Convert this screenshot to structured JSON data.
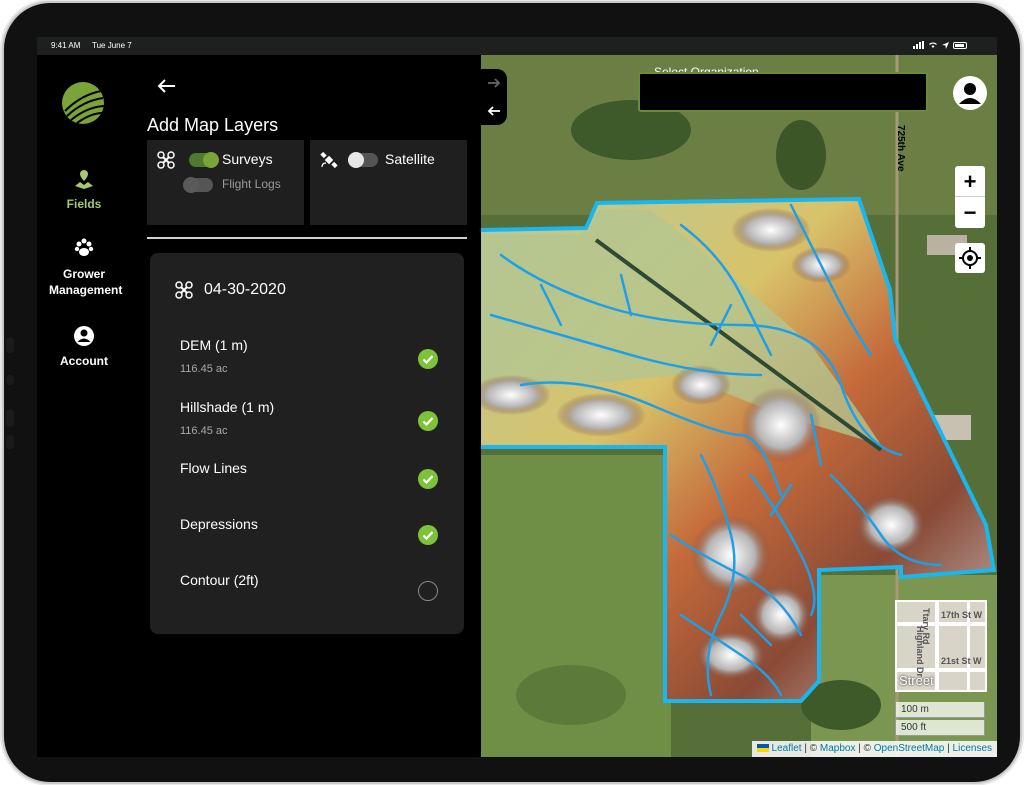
{
  "status_bar": {
    "time": "9:41 AM",
    "date": "Tue June 7"
  },
  "nav": {
    "items": [
      {
        "label": "Fields",
        "icon": "field-pin-icon",
        "active": true
      },
      {
        "label": "Grower Management",
        "icon": "paw-icon",
        "active": false
      },
      {
        "label": "Account",
        "icon": "account-circle-icon",
        "active": false
      }
    ]
  },
  "panel": {
    "title": "Add Map Layers",
    "layers": {
      "surveys_label": "Surveys",
      "flight_logs_label": "Flight Logs",
      "satellite_label": "Satellite"
    },
    "survey": {
      "date": "04-30-2020",
      "rows": [
        {
          "name": "DEM (1 m)",
          "area": "116.45 ac",
          "checked": true
        },
        {
          "name": "Hillshade (1 m)",
          "area": "116.45 ac",
          "checked": true
        },
        {
          "name": "Flow Lines",
          "area": "",
          "checked": true
        },
        {
          "name": "Depressions",
          "area": "",
          "checked": true
        },
        {
          "name": "Contour (2ft)",
          "area": "",
          "checked": false
        }
      ]
    }
  },
  "map": {
    "org_select_label": "Select Organization",
    "road_label": "725th Ave",
    "zoom_in": "+",
    "zoom_out": "−",
    "minimap": {
      "label": "Street",
      "streets": [
        "17th St W",
        "21st St W",
        "Highland Dr",
        "Ttary Rd"
      ]
    },
    "scale": {
      "metric": "100 m",
      "imperial": "500 ft"
    },
    "attribution": {
      "leaflet": "Leaflet",
      "sep1": " | © ",
      "mapbox": "Mapbox",
      "sep2": " | © ",
      "osm": "OpenStreetMap",
      "sep3": " | ",
      "licenses": "Licenses"
    }
  },
  "colors": {
    "accent_green": "#7ec23b",
    "field_outline": "#1ab6f0",
    "nav_active": "#a7c770"
  }
}
